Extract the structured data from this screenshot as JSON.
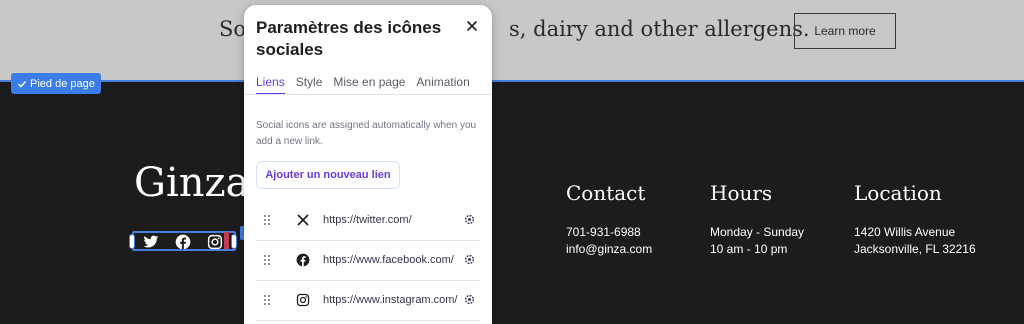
{
  "banner": {
    "text_left": "So",
    "text_right": "s, dairy and other allergens.",
    "learn_more_label": "Learn more"
  },
  "footer_tag": {
    "label": "Pied de page",
    "icon": "check-icon"
  },
  "footer": {
    "brand": "Ginza",
    "social_icons": [
      "twitter-icon",
      "facebook-icon",
      "instagram-icon"
    ],
    "contact": {
      "title": "Contact",
      "phone": "701-931-6988",
      "email": "info@ginza.com"
    },
    "hours": {
      "title": "Hours",
      "days": "Monday - Sunday",
      "time": "10 am - 10 pm"
    },
    "location": {
      "title": "Location",
      "street": "1420 Willis Avenue",
      "city": "Jacksonville, FL 32216"
    }
  },
  "panel": {
    "title": "Paramètres des icônes sociales",
    "tabs": [
      {
        "label": "Liens",
        "active": true
      },
      {
        "label": "Style",
        "active": false
      },
      {
        "label": "Mise en page",
        "active": false
      },
      {
        "label": "Animation",
        "active": false
      }
    ],
    "description": "Social icons are assigned automatically when you add a new link.",
    "add_link_label": "Ajouter un nouveau lien",
    "links": [
      {
        "icon": "x-icon",
        "url": "https://twitter.com/"
      },
      {
        "icon": "facebook-icon",
        "url": "https://www.facebook.com/"
      },
      {
        "icon": "instagram-icon",
        "url": "https://www.instagram.com/"
      }
    ]
  },
  "colors": {
    "accent_purple": "#673de6",
    "selection_blue": "#3a7de8",
    "footer_bg": "#1c1c1c",
    "banner_bg": "#c8c8c8"
  }
}
